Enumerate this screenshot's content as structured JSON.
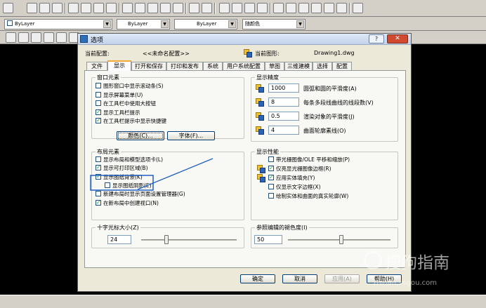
{
  "toolbar": {
    "layer_combo": "ByLayer",
    "linetype_combo": "ByLayer",
    "lineweight_combo": "ByLayer",
    "color_combo": "随颜色"
  },
  "dialog": {
    "title": "选项",
    "help_label": "?",
    "close_label": "✕",
    "current_profile_label": "当前配置:",
    "current_profile_value": "<<未命名配置>>",
    "current_drawing_label": "当前图形:",
    "current_drawing_value": "Drawing1.dwg",
    "tabs": [
      "文件",
      "显示",
      "打开和保存",
      "打印和发布",
      "系统",
      "用户系统配置",
      "草图",
      "三维建模",
      "选择",
      "配置"
    ],
    "active_tab": "显示",
    "window_elements": {
      "title": "窗口元素",
      "options": [
        {
          "label": "图形窗口中显示滚动条(S)",
          "checked": false
        },
        {
          "label": "显示屏幕菜单(U)",
          "checked": false
        },
        {
          "label": "在工具栏中使用大按钮",
          "checked": false
        },
        {
          "label": "显示工具栏提示",
          "checked": true
        },
        {
          "label": "在工具栏提示中显示快捷键",
          "checked": true
        }
      ],
      "colors_button": "颜色(C)...",
      "fonts_button": "字体(F)..."
    },
    "layout_elements": {
      "title": "布局元素",
      "options": [
        {
          "label": "显示布局和模型选项卡(L)",
          "checked": false
        },
        {
          "label": "显示可打印区域(B)",
          "checked": true
        },
        {
          "label": "显示图纸背景(K)",
          "checked": true
        },
        {
          "label": "显示图纸阴影(E)",
          "checked": false
        },
        {
          "label": "新建布局时显示页面设置管理器(G)",
          "checked": false
        },
        {
          "label": "在新布局中创建视口(N)",
          "checked": true
        }
      ]
    },
    "crosshair": {
      "title": "十字光标大小(Z)",
      "value": "24",
      "slider_fraction": 0.24
    },
    "display_resolution": {
      "title": "显示精度",
      "items": [
        {
          "value": "1000",
          "label": "圆弧和圆的平滑度(A)"
        },
        {
          "value": "8",
          "label": "每条多段线曲线的线段数(V)"
        },
        {
          "value": "0.5",
          "label": "渲染对象的平滑度(J)"
        },
        {
          "value": "4",
          "label": "曲面轮廓素线(O)"
        }
      ]
    },
    "display_performance": {
      "title": "显示性能",
      "options": [
        {
          "label": "带光栅图像/OLE 平移和缩放(P)",
          "checked": false
        },
        {
          "label": "仅亮显光栅图像边框(R)",
          "checked": true
        },
        {
          "label": "应用实体填充(Y)",
          "checked": true
        },
        {
          "label": "仅显示文字边框(X)",
          "checked": false
        },
        {
          "label": "绘制实体和曲面的真实轮廓(W)",
          "checked": false
        }
      ]
    },
    "fade": {
      "title": "参照编辑的褪色度(I)",
      "value": "50",
      "slider_fraction": 0.5
    },
    "buttons": {
      "ok": "确定",
      "cancel": "取消",
      "apply": "应用(A)",
      "help": "帮助(H)"
    }
  },
  "watermark": {
    "text": "搜狗指南",
    "url": "zhinan.sogou.com"
  },
  "colors": {
    "accent_tab": "#f1a93a",
    "annotation": "#1f5fbf"
  }
}
